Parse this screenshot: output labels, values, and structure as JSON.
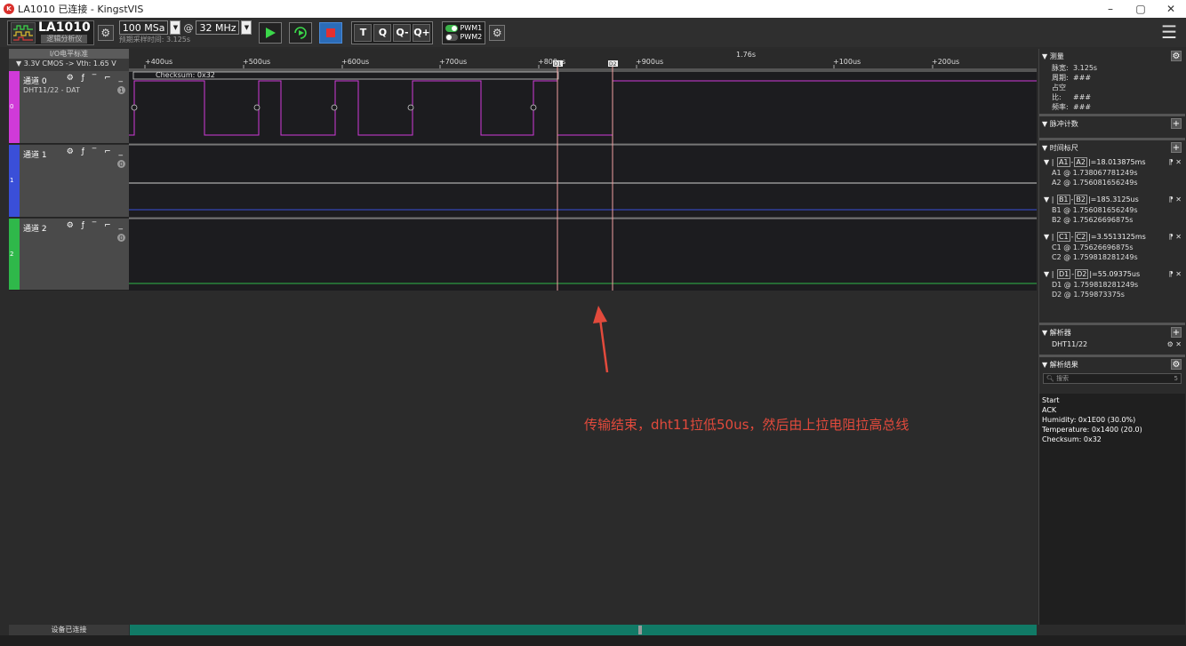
{
  "window": {
    "title": "LA1010 已连接 - KingstVIS",
    "minimize": "–",
    "restore": "▢",
    "close": "✕"
  },
  "toolbar": {
    "device_name": "LA1010",
    "device_sub": "逻辑分析仪",
    "sample_rate": "100 MSa",
    "sample_depth": "32 MHz",
    "at": "@",
    "sample_time": "预期采样时间: 3.125s",
    "tools": [
      "T",
      "Q",
      "Q-",
      "Q+"
    ],
    "pwm1": "PWM1",
    "pwm2": "PWM2"
  },
  "left_header": {
    "title": "I/O电平标准",
    "value": "▼ 3.3V CMOS -> Vth: 1.65 V"
  },
  "channels": [
    {
      "name": "通道 0",
      "sub": "DHT11/22 - DAT",
      "index": "0",
      "badge": "1",
      "color": "#d03ad8"
    },
    {
      "name": "通道 1",
      "sub": "",
      "index": "1",
      "badge": "0",
      "color": "#3a4fd8"
    },
    {
      "name": "通道 2",
      "sub": "",
      "index": "2",
      "badge": "0",
      "color": "#2fb84a"
    }
  ],
  "ruler": {
    "ticks": [
      "+400us",
      "+500us",
      "+600us",
      "+700us",
      "+800us",
      "+900us",
      "+100us",
      "+200us"
    ],
    "center": "1.76s",
    "checksum": "Checksum: 0x32",
    "cursor_a": "D1",
    "cursor_b": "D2"
  },
  "annotation": "传输结束，dht11拉低50us，然后由上拉电阻拉高总线",
  "right_panel": {
    "measure_title": "▼ 测量",
    "measure": [
      {
        "label": "脉宽:",
        "value": "3.125s"
      },
      {
        "label": "周期:",
        "value": "###"
      },
      {
        "label": "占空比:",
        "value": "###"
      },
      {
        "label": "频率:",
        "value": "###"
      }
    ],
    "pulse_title": "▼ 脉冲计数",
    "timer_title": "▼ 时间标尺",
    "pairs": [
      {
        "a": "A1",
        "b": "A2",
        "delta": "|=18.013875ms",
        "l1": "A1 @ 1.738067781249s",
        "l2": "A2 @ 1.756081656249s"
      },
      {
        "a": "B1",
        "b": "B2",
        "delta": "|=185.3125us",
        "l1": "B1 @ 1.756081656249s",
        "l2": "B2 @ 1.75626696875s"
      },
      {
        "a": "C1",
        "b": "C2",
        "delta": "|=3.5513125ms",
        "l1": "C1 @ 1.75626696875s",
        "l2": "C2 @ 1.759818281249s"
      },
      {
        "a": "D1",
        "b": "D2",
        "delta": "|=55.09375us",
        "l1": "D1 @ 1.759818281249s",
        "l2": "D2 @ 1.759873375s"
      }
    ],
    "analyzer_title": "▼ 解析器",
    "analyzer_item": "DHT11/22",
    "results_title": "▼ 解析结果",
    "search_placeholder": "搜索",
    "result_count": "5",
    "results": [
      "Start",
      "ACK",
      "Humidity: 0x1E00 (30.0%)",
      "Temperature: 0x1400 (20.0)",
      "Checksum: 0x32"
    ]
  },
  "status": {
    "text": "设备已连接"
  }
}
